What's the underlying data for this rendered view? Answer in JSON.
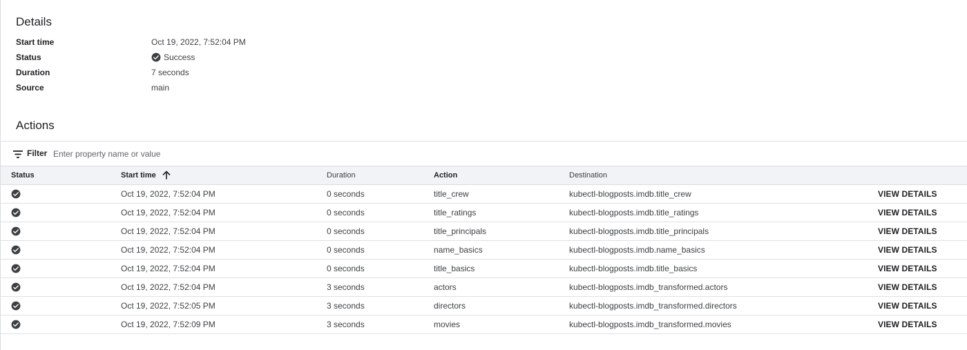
{
  "details": {
    "title": "Details",
    "fields": [
      {
        "label": "Start time",
        "value": "Oct 19, 2022, 7:52:04 PM"
      },
      {
        "label": "Status",
        "value": "Success",
        "icon": "check-circle-icon"
      },
      {
        "label": "Duration",
        "value": "7 seconds"
      },
      {
        "label": "Source",
        "value": "main"
      }
    ]
  },
  "actions": {
    "title": "Actions",
    "filter": {
      "label": "Filter",
      "placeholder": "Enter property name or value",
      "value": "",
      "icon": "filter-icon"
    },
    "columns": {
      "status": "Status",
      "start_time": "Start time",
      "duration": "Duration",
      "action": "Action",
      "destination": "Destination"
    },
    "sort": {
      "column": "start_time",
      "direction": "ascending",
      "icon": "arrow-up-icon"
    },
    "view_details_label": "VIEW DETAILS",
    "rows": [
      {
        "start_time": "Oct 19, 2022, 7:52:04 PM",
        "duration": "0 seconds",
        "action": "title_crew",
        "destination": "kubectl-blogposts.imdb.title_crew"
      },
      {
        "start_time": "Oct 19, 2022, 7:52:04 PM",
        "duration": "0 seconds",
        "action": "title_ratings",
        "destination": "kubectl-blogposts.imdb.title_ratings"
      },
      {
        "start_time": "Oct 19, 2022, 7:52:04 PM",
        "duration": "0 seconds",
        "action": "title_principals",
        "destination": "kubectl-blogposts.imdb.title_principals"
      },
      {
        "start_time": "Oct 19, 2022, 7:52:04 PM",
        "duration": "0 seconds",
        "action": "name_basics",
        "destination": "kubectl-blogposts.imdb.name_basics"
      },
      {
        "start_time": "Oct 19, 2022, 7:52:04 PM",
        "duration": "0 seconds",
        "action": "title_basics",
        "destination": "kubectl-blogposts.imdb.title_basics"
      },
      {
        "start_time": "Oct 19, 2022, 7:52:04 PM",
        "duration": "3 seconds",
        "action": "actors",
        "destination": "kubectl-blogposts.imdb_transformed.actors"
      },
      {
        "start_time": "Oct 19, 2022, 7:52:05 PM",
        "duration": "3 seconds",
        "action": "directors",
        "destination": "kubectl-blogposts.imdb_transformed.directors"
      },
      {
        "start_time": "Oct 19, 2022, 7:52:09 PM",
        "duration": "3 seconds",
        "action": "movies",
        "destination": "kubectl-blogposts.imdb_transformed.movies"
      }
    ]
  },
  "colors": {
    "status_icon": "#3c4043",
    "header_bg": "#f1f3f4",
    "divider": "#dadce0"
  }
}
